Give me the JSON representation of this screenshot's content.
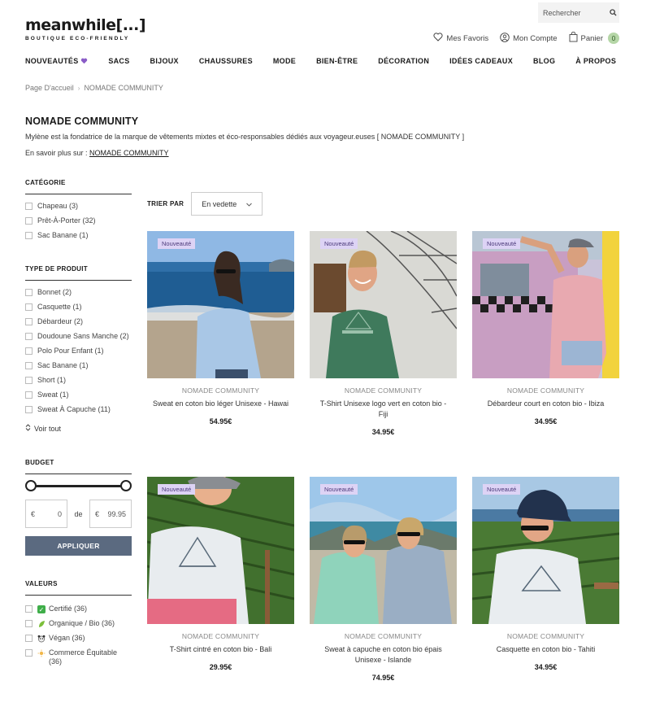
{
  "logo": {
    "main": "meanwhile[...]",
    "sub": "BOUTIQUE ECO-FRIENDLY"
  },
  "search": {
    "placeholder": "Rechercher"
  },
  "account": {
    "favorites": "Mes Favoris",
    "account": "Mon Compte",
    "cart": "Panier",
    "cart_count": "0"
  },
  "nav": [
    {
      "label": "NOUVEAUTÉS",
      "icon": "purple-heart"
    },
    {
      "label": "SACS"
    },
    {
      "label": "BIJOUX"
    },
    {
      "label": "CHAUSSURES"
    },
    {
      "label": "MODE"
    },
    {
      "label": "BIEN-ÊTRE"
    },
    {
      "label": "DÉCORATION"
    },
    {
      "label": "IDÉES CADEAUX"
    },
    {
      "label": "BLOG"
    },
    {
      "label": "À PROPOS"
    }
  ],
  "breadcrumb": {
    "home": "Page D'accueil",
    "separator": ">",
    "current": "NOMADE COMMUNITY"
  },
  "page": {
    "title": "NOMADE COMMUNITY",
    "description": "Mylène est la fondatrice de la marque de vêtements mixtes et éco-responsables dédiés aux voyageur.euses [ NOMADE COMMUNITY ]",
    "more_prefix": "En savoir plus sur : ",
    "more_link": "NOMADE COMMUNITY"
  },
  "filters": {
    "category": {
      "title": "CATÉGORIE",
      "items": [
        "Chapeau (3)",
        "Prêt-À-Porter (32)",
        "Sac Banane (1)"
      ]
    },
    "product_type": {
      "title": "TYPE DE PRODUIT",
      "items": [
        "Bonnet (2)",
        "Casquette (1)",
        "Débardeur (2)",
        "Doudoune Sans Manche (2)",
        "Polo Pour Enfant (1)",
        "Sac Banane (1)",
        "Short (1)",
        "Sweat (1)",
        "Sweat À Capuche (11)"
      ],
      "see_all": "Voir tout"
    },
    "budget": {
      "title": "BUDGET",
      "currency": "€",
      "min": "0",
      "between": "de",
      "max": "99.95",
      "apply": "APPLIQUER"
    },
    "values": {
      "title": "VALEURS",
      "items": [
        {
          "label": "Certifié (36)",
          "icon": "green-check"
        },
        {
          "label": "Organique / Bio (36)",
          "icon": "leaf"
        },
        {
          "label": "Végan (36)",
          "icon": "panda"
        },
        {
          "label": "Commerce Équitable (36)",
          "icon": "fair-trade"
        }
      ]
    }
  },
  "sort": {
    "label": "TRIER PAR",
    "value": "En vedette"
  },
  "products": [
    {
      "badge": "Nouveauté",
      "brand": "NOMADE COMMUNITY",
      "name": "Sweat en coton bio léger Unisexe - Hawai",
      "price": "54.95€",
      "image": "woman-light-blue-sweater-beach"
    },
    {
      "badge": "Nouveauté",
      "brand": "NOMADE COMMUNITY",
      "name": "T-Shirt Unisexe logo vert en coton bio - Fiji",
      "price": "34.95€",
      "image": "man-green-tshirt-dome"
    },
    {
      "badge": "Nouveauté",
      "brand": "NOMADE COMMUNITY",
      "name": "Débardeur court en coton bio - Ibiza",
      "price": "34.95€",
      "image": "woman-pink-tank-van"
    },
    {
      "badge": "Nouveauté",
      "brand": "NOMADE COMMUNITY",
      "name": "T-Shirt cintré en coton bio - Bali",
      "price": "29.95€",
      "image": "woman-white-tshirt-vineyard"
    },
    {
      "badge": "Nouveauté",
      "brand": "NOMADE COMMUNITY",
      "name": "Sweat à capuche en coton bio épais Unisexe - Islande",
      "price": "74.95€",
      "image": "two-women-hoodies-lake"
    },
    {
      "badge": "Nouveauté",
      "brand": "NOMADE COMMUNITY",
      "name": "Casquette en coton bio - Tahiti",
      "price": "34.95€",
      "image": "woman-navy-cap-vineyard"
    }
  ]
}
